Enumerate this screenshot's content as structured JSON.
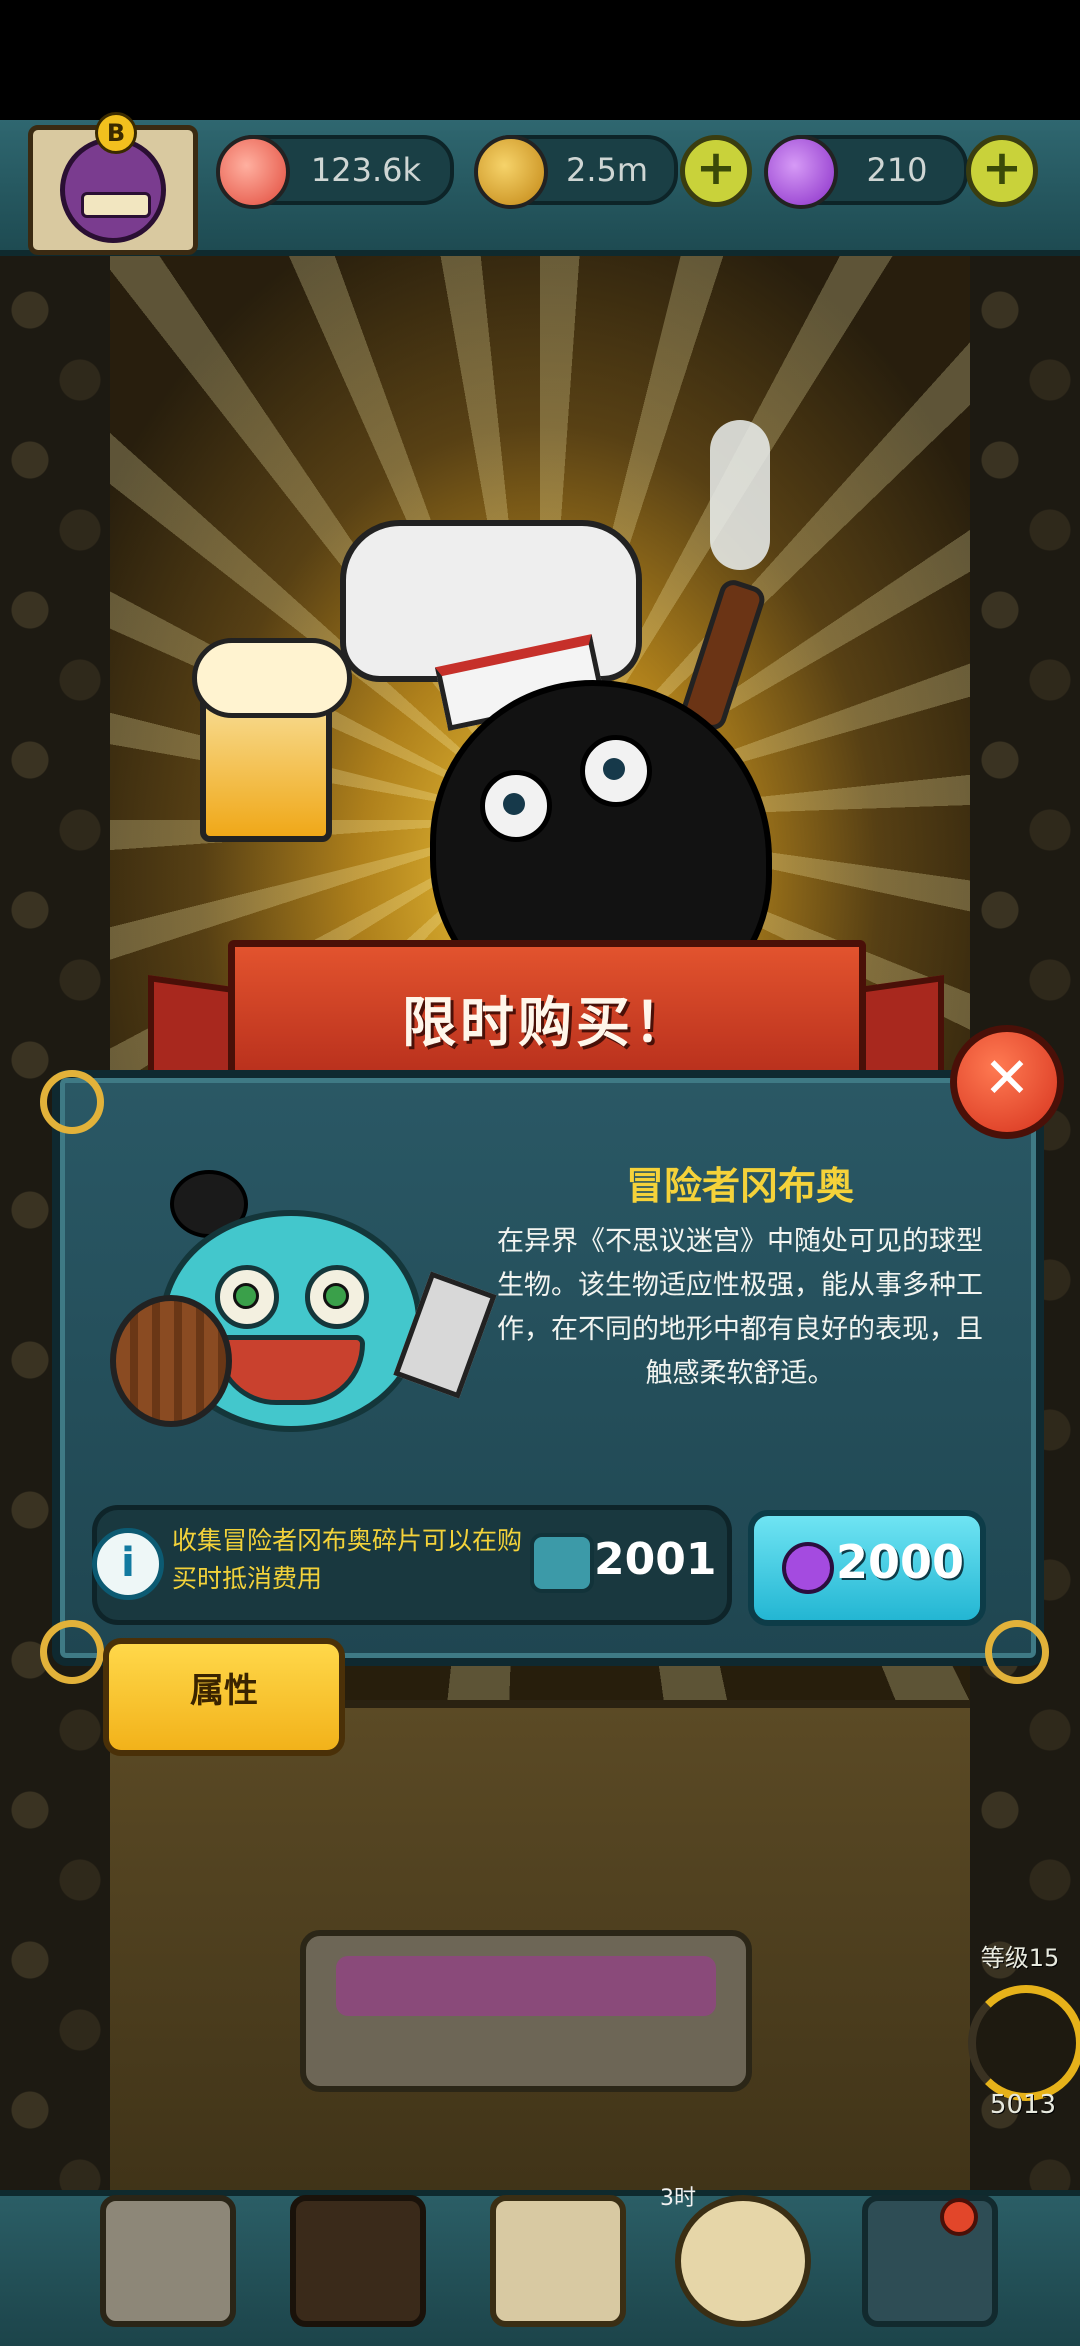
{
  "resources": {
    "eyeballs": {
      "value": "123.6k",
      "icon": "eyeball-icon",
      "color": "#e24b3c"
    },
    "coins": {
      "value": "2.5m",
      "icon": "coin-icon",
      "color": "#d8a21e"
    },
    "potions": {
      "value": "210",
      "icon": "potion-icon",
      "color": "#a44be0"
    }
  },
  "banner": {
    "title": "限时购买！"
  },
  "offer": {
    "name": "冒险者冈布奥",
    "description": "在异界《不思议迷宫》中随处可见的球型生物。该生物适应性极强，能从事多种工作，在不同的地形中都有良好的表现，且触感柔软舒适。",
    "info_text": "收集冒险者冈布奥碎片可以在购买时抵消费用",
    "fragment_count": "2001",
    "price": "2000"
  },
  "tabs": {
    "attributes": "属性"
  },
  "status": {
    "level": "等级15",
    "progress_value": "5013"
  },
  "bottom_nav": {
    "floor_label": "3时"
  },
  "colors": {
    "accent_gold": "#f5d23a",
    "banner_red": "#d6412a",
    "panel_teal": "#24505b",
    "buy_cyan": "#3fcbe0"
  }
}
